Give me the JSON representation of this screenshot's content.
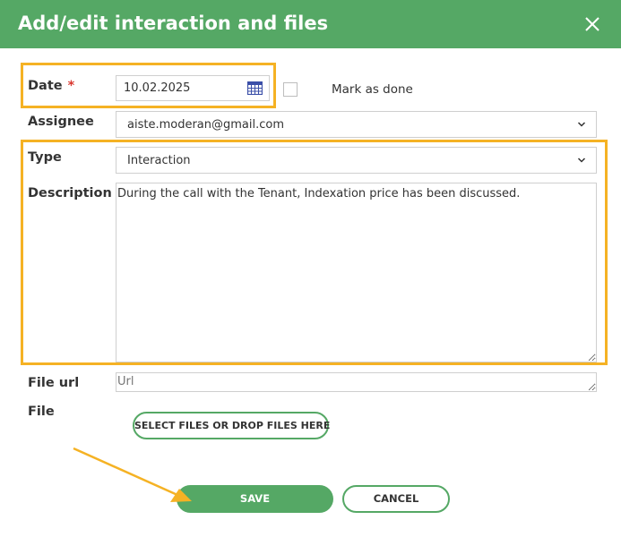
{
  "dialog": {
    "title": "Add/edit interaction and files"
  },
  "form": {
    "date": {
      "label": "Date",
      "required_mark": "*",
      "value": "10.02.2025"
    },
    "mark_done": {
      "label": "Mark as done",
      "checked": false
    },
    "assignee": {
      "label": "Assignee",
      "value": "aiste.moderan@gmail.com"
    },
    "type": {
      "label": "Type",
      "value": "Interaction"
    },
    "description": {
      "label": "Description",
      "value": "During the call with the Tenant, Indexation price has been discussed."
    },
    "file_url": {
      "label": "File url",
      "placeholder": "Url"
    },
    "file": {
      "label": "File",
      "button_label": "SELECT FILES OR DROP FILES HERE"
    }
  },
  "actions": {
    "save_label": "SAVE",
    "cancel_label": "CANCEL"
  },
  "colors": {
    "accent": "#55a865",
    "highlight": "#f5b224",
    "required": "#d9372f",
    "calendar_icon": "#3b4fa8"
  },
  "icons": {
    "close": "close-icon",
    "calendar": "calendar-icon",
    "dropdown": "chevron-down-icon",
    "annotation": "arrow-annotation"
  }
}
